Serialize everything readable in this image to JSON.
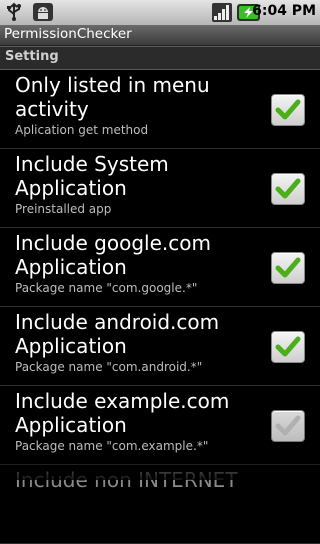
{
  "status_bar": {
    "time": "6:04 PM",
    "icons": [
      "usb-icon",
      "android-debug-icon",
      "signal-icon",
      "battery-charging-icon"
    ]
  },
  "app": {
    "title": "PermissionChecker"
  },
  "section": {
    "title": "Setting"
  },
  "preferences": [
    {
      "title": "Only listed in menu activity",
      "summary": "Aplication get method",
      "checked": true,
      "enabled": true
    },
    {
      "title": "Include System Application",
      "summary": "Preinstalled app",
      "checked": true,
      "enabled": true
    },
    {
      "title": "Include google.com Application",
      "summary": "Package name \"com.google.*\"",
      "checked": true,
      "enabled": true
    },
    {
      "title": "Include android.com Application",
      "summary": "Package name \"com.android.*\"",
      "checked": true,
      "enabled": true
    },
    {
      "title": "Include example.com Application",
      "summary": "Package name \"com.example.*\"",
      "checked": true,
      "enabled": false
    },
    {
      "title": "Include non INTERNET",
      "summary": "",
      "checked": false,
      "enabled": true
    }
  ],
  "colors": {
    "check_green": "#4caf19",
    "check_disabled": "#b0b0b0"
  }
}
